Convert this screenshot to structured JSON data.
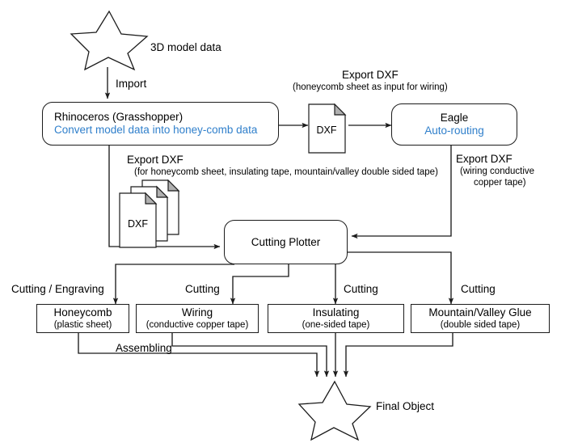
{
  "diagram": {
    "title": "3D model fabrication workflow",
    "accent_blue": "#2f7fcb",
    "line_color": "#1b1b1b"
  },
  "shapes": {
    "top_star_label": "3D model data",
    "bottom_star_label": "Final Object"
  },
  "nodes": {
    "rhinoceros": {
      "title": "Rhinoceros (Grasshopper)",
      "subtitle": "Convert model data into honey-comb data"
    },
    "eagle": {
      "title": "Eagle",
      "subtitle": "Auto-routing"
    },
    "cutting_plotter": {
      "title": "Cutting Plotter"
    },
    "dxf_single": {
      "label": "DXF"
    },
    "dxf_stack": {
      "label": "DXF"
    }
  },
  "outputs": [
    {
      "title": "Honeycomb",
      "subtitle": "(plastic sheet)"
    },
    {
      "title": "Wiring",
      "subtitle": "(conductive copper tape)"
    },
    {
      "title": "Insulating",
      "subtitle": "(one-sided tape)"
    },
    {
      "title": "Mountain/Valley Glue",
      "subtitle": "(double sided tape)"
    }
  ],
  "edge_labels": {
    "import": "Import",
    "export_dxf_top_line1": "Export DXF",
    "export_dxf_top_line2": "(honeycomb sheet as input for wiring)",
    "export_dxf_mid_line1": "Export DXF",
    "export_dxf_mid_line2": "(for honeycomb sheet, insulating tape, mountain/valley double sided tape)",
    "export_dxf_right_line1": "Export DXF",
    "export_dxf_right_line2": "(wiring conductive",
    "export_dxf_right_line3": "copper tape)",
    "cutting_engraving": "Cutting / Engraving",
    "cutting_2": "Cutting",
    "cutting_3": "Cutting",
    "cutting_4": "Cutting",
    "assembling": "Assembling"
  }
}
